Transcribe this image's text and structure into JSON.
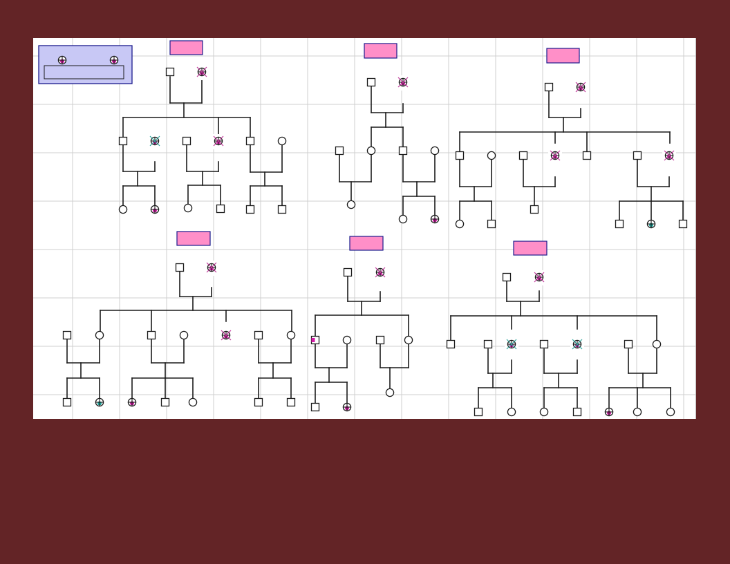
{
  "colors": {
    "background": "#632426",
    "canvas": "#ffffff",
    "grid_line": "#cfcfcf",
    "line": "#1a1a1a",
    "legend_fill": "#c8c8f5",
    "legend_border": "#1a1a8c",
    "title_box_fill": "#ff8fc8",
    "title_box_border": "#1a1a8c",
    "carrier_dot_teal": "#1aa39a",
    "carrier_dot_magenta": "#d41aa6",
    "deceased_mark_teal": "#33a7a0",
    "deceased_mark_magenta": "#c0399a"
  },
  "icon_names": [
    "square-male-icon",
    "circle-female-icon",
    "crossed-circle-female-icon",
    "deceased-female-icon"
  ],
  "legend": {
    "label": ""
  },
  "families": [
    {
      "title": ""
    },
    {
      "title": ""
    },
    {
      "title": ""
    },
    {
      "title": ""
    },
    {
      "title": ""
    },
    {
      "title": ""
    }
  ]
}
